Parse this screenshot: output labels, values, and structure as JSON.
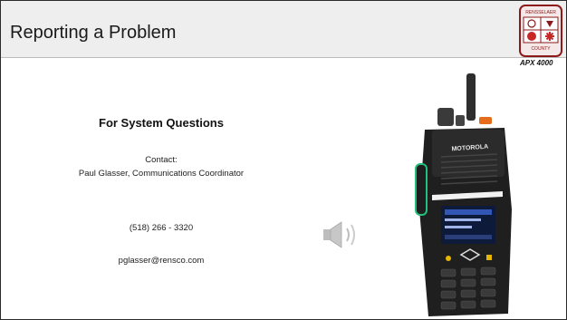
{
  "slide": {
    "title": "Reporting a Problem",
    "model_label": "APX 4000"
  },
  "contact": {
    "heading": "For System Questions",
    "contact_label": "Contact:",
    "name_role": "Paul Glasser,  Communications Coordinator",
    "phone": "(518) 266 - 3320",
    "email": "pglasser@rensco.com"
  },
  "seal": {
    "top_text": "RENSSELAER",
    "bottom_text": "COUNTY"
  },
  "radio": {
    "brand": "MOTOROLA"
  },
  "icons": [
    "county-seal-icon",
    "speaker-icon",
    "radio-image"
  ]
}
